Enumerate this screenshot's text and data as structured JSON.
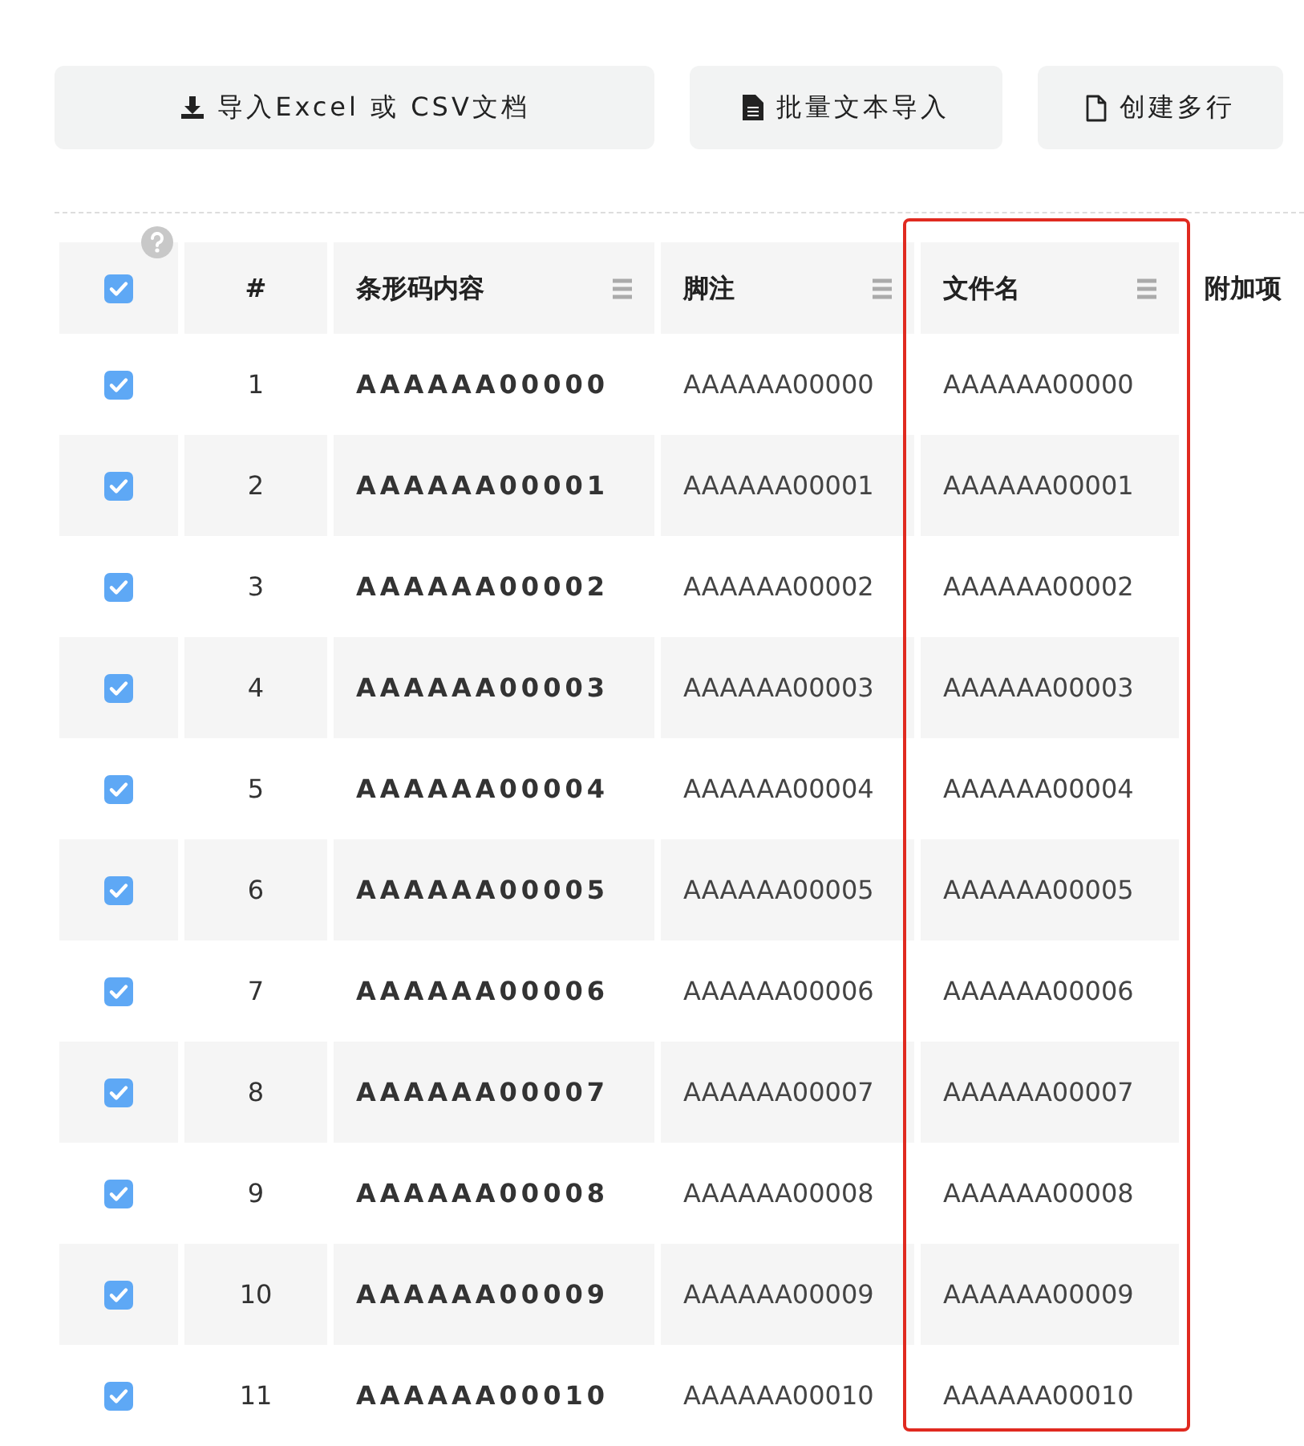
{
  "toolbar": [
    {
      "label": "导入Excel 或 CSV文档"
    },
    {
      "label": "批量文本导入"
    },
    {
      "label": "创建多行"
    }
  ],
  "table": {
    "all_checked": true,
    "columns": [
      {
        "label": "#",
        "kind": "index",
        "menu": false,
        "highlighted": false
      },
      {
        "label": "条形码内容",
        "kind": "barcode",
        "menu": true,
        "highlighted": false
      },
      {
        "label": "脚注",
        "kind": "text",
        "menu": true,
        "highlighted": false
      },
      {
        "label": "文件名",
        "kind": "text",
        "menu": true,
        "highlighted": true
      },
      {
        "label": "附加项",
        "kind": "extra",
        "menu": false,
        "highlighted": false
      }
    ],
    "rows": [
      {
        "checked": true,
        "cells": [
          "1",
          "AAAAAA00000",
          "AAAAAA00000",
          "AAAAAA00000"
        ]
      },
      {
        "checked": true,
        "cells": [
          "2",
          "AAAAAA00001",
          "AAAAAA00001",
          "AAAAAA00001"
        ]
      },
      {
        "checked": true,
        "cells": [
          "3",
          "AAAAAA00002",
          "AAAAAA00002",
          "AAAAAA00002"
        ]
      },
      {
        "checked": true,
        "cells": [
          "4",
          "AAAAAA00003",
          "AAAAAA00003",
          "AAAAAA00003"
        ]
      },
      {
        "checked": true,
        "cells": [
          "5",
          "AAAAAA00004",
          "AAAAAA00004",
          "AAAAAA00004"
        ]
      },
      {
        "checked": true,
        "cells": [
          "6",
          "AAAAAA00005",
          "AAAAAA00005",
          "AAAAAA00005"
        ]
      },
      {
        "checked": true,
        "cells": [
          "7",
          "AAAAAA00006",
          "AAAAAA00006",
          "AAAAAA00006"
        ]
      },
      {
        "checked": true,
        "cells": [
          "8",
          "AAAAAA00007",
          "AAAAAA00007",
          "AAAAAA00007"
        ]
      },
      {
        "checked": true,
        "cells": [
          "9",
          "AAAAAA00008",
          "AAAAAA00008",
          "AAAAAA00008"
        ]
      },
      {
        "checked": true,
        "cells": [
          "10",
          "AAAAAA00009",
          "AAAAAA00009",
          "AAAAAA00009"
        ]
      },
      {
        "checked": true,
        "cells": [
          "11",
          "AAAAAA00010",
          "AAAAAA00010",
          "AAAAAA00010"
        ]
      }
    ]
  }
}
